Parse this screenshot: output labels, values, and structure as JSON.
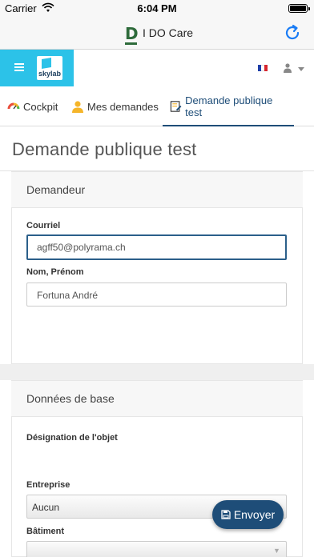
{
  "status_bar": {
    "carrier": "Carrier",
    "time": "6:04 PM"
  },
  "nav_bar": {
    "logo_letter": "D",
    "title": "I DO Care"
  },
  "app_bar": {
    "brand": "skylab",
    "language": "fr"
  },
  "tabs": [
    {
      "label": "Cockpit",
      "icon": "cockpit-icon",
      "active": false
    },
    {
      "label": "Mes demandes",
      "icon": "user-icon",
      "active": false
    },
    {
      "label": "Demande publique test",
      "icon": "form-icon",
      "active": true
    }
  ],
  "page": {
    "title": "Demande publique test"
  },
  "demandeur": {
    "heading": "Demandeur",
    "courriel_label": "Courriel",
    "courriel_value": "agff50@polyrama.ch",
    "nom_label": "Nom, Prénom",
    "nom_value": "Fortuna André"
  },
  "donnees": {
    "heading": "Données de base",
    "designation_label": "Désignation de l'objet",
    "entreprise_label": "Entreprise",
    "entreprise_value": "Aucun",
    "batiment_label": "Bâtiment",
    "batiment_value": ""
  },
  "actions": {
    "send_label": "Envoyer"
  },
  "colors": {
    "brand": "#2cc2e8",
    "primary": "#1e4d78",
    "logo_green": "#2e6b3b"
  }
}
